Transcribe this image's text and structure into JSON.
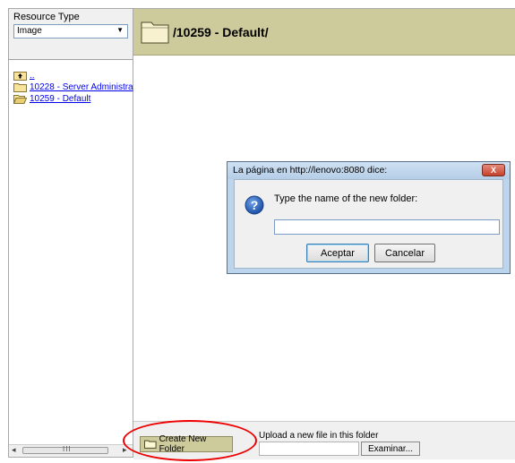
{
  "left_pane": {
    "resource_type_label": "Resource Type",
    "resource_type_value": "Image",
    "tree": {
      "up_label": "..",
      "items": [
        {
          "label": "10228 - Server Administra"
        },
        {
          "label": "10259 - Default"
        }
      ]
    },
    "scrollbar_grip": "III"
  },
  "header": {
    "path": "/10259 - Default/"
  },
  "footer": {
    "create_folder_label": "Create New Folder",
    "upload_label": "Upload a new file in this folder",
    "browse_label": "Examinar..."
  },
  "dialog": {
    "title": "La página en http://lenovo:8080 dice:",
    "close_label": "X",
    "message": "Type the name of the new folder:",
    "input_value": "",
    "ok_label": "Aceptar",
    "cancel_label": "Cancelar"
  },
  "colors": {
    "accent_olive": "#cdca9c",
    "annotation_red": "#e00000",
    "link_blue": "#0000ee"
  }
}
